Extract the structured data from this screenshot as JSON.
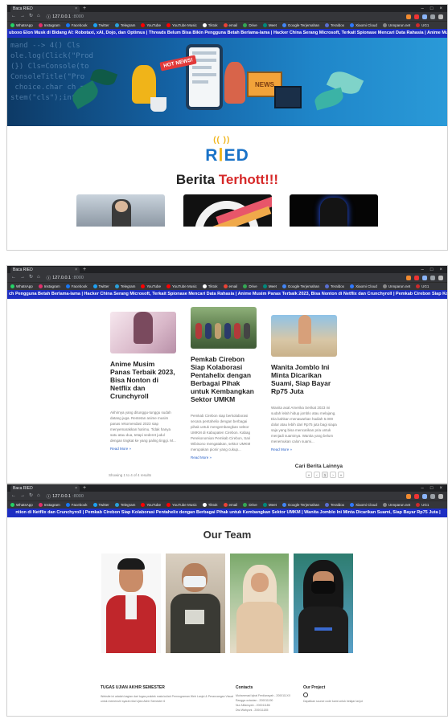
{
  "browser": {
    "tab_title": "Bacа RIED",
    "new_tab": "+",
    "url_host": "127.0.0.1",
    "url_port": ":8000",
    "url_host_2": "127.0.0.1",
    "url_port_2": ":8000",
    "url_host_3": "127.0.0.1",
    "url_port_3": ":8000",
    "bookmarks": [
      "WhatsApp",
      "Instagram",
      "Facebook",
      "Twitter",
      "Telegram",
      "YouTube",
      "YouTube Music",
      "Tiktok",
      "email",
      "Drive",
      "Meet",
      "Google Terjemahan",
      "Teraldox",
      "Xiaomi Cloud",
      "Unnparun.net",
      "UG1"
    ],
    "bookmark_colors": [
      "#25d366",
      "#e1306c",
      "#1877f2",
      "#1da1f2",
      "#2aa1da",
      "#ff0000",
      "#ff0000",
      "#ffffff",
      "#ea4335",
      "#34a853",
      "#00897b",
      "#4285f4",
      "#5a6fd0",
      "#2f78ff",
      "#888888",
      "#cc2b2b"
    ]
  },
  "screen1": {
    "ticker": "uboxo Elon Musk di Bidang AI: Robotaxi, xAI, Dojo, dan Optimus | Threads Belum Bisa Bikin Pengguna Betah Berlama-lama | Hacker China Serang Microsoft, Terkait Spionase Mencari Data Rahasia | Anime Musim Panas Terbaik 2023",
    "hero_badge": "HOT NEWS!",
    "hero_board": "NEWS",
    "logo_left": "R",
    "logo_right": "ED",
    "section_title_black": "Berita ",
    "section_title_red": "Terhott!!!"
  },
  "screen2": {
    "ticker": "ch Pengguna Betah Berlama-lama | Hacker China Serang Microsoft, Terkait Spionase Mencari Data Rahasia | Anime Musim Panas Terbaik 2023, Bisa Nonton di Netflix dan Crunchyroll | Pemkab Cirebon Siap Kolaborasi Pentahelix dengan",
    "cards": [
      {
        "title": "Anime Musim Panas Terbaik 2023, Bisa Nonton di Netflix dan Crunchyroll",
        "body": "Akhirnya yang ditunggu-tunggu sudah datang juga. Rentetan anime musim panas rekomendasi 2023 siap menyemarakkan harimu. Tidak hanya satu atau dua, tetapi sederet judul dengan tingkat ke yang paling tinggi. M...",
        "more": "Read More »"
      },
      {
        "title": "Pemkab Cirebon Siap Kolaborasi Pentahelix dengan Berbagai Pihak untuk Kembangkan Sektor UMKM",
        "body": "Pemkab Cirebon siap berkolaborasi secara pentahelix dengan berbagai pihak untuk mengembangkan sektor UMKM di Kabupaten Cirebon. Kabag Perekonomian Pemkab Cirebon, Sari Wibisono mengatakan, sektor UMKM merupakan pionir yang cukup...",
        "more": "Read More »"
      },
      {
        "title": "Wanita Jomblo Ini Minta Dicarikan Suami, Siap Bayar Rp75 Juta",
        "body": "Wanita asal Amerika Serikat 2023 ini sudah lelah hidup jomblo atau melajang. Dia bahkan menawarkan hadiah 5.000 dolar atau lebih dari Rp75 juta bagi siapa saja yang bisa mencarikan pria untuk menjadi suaminya. Wanita yang belum menemukan calon suami...",
        "more": "Read More »"
      }
    ],
    "showing": "Showing 1 to 4 of 4 results",
    "cari_label": "Cari Berita Lainnya",
    "pager": [
      "«",
      "‹",
      "1",
      "›",
      "»"
    ]
  },
  "screen3": {
    "ticker": "ntion di Netflix dan Crunchyroll | Pemkab Cirebon Siap Kolaborasi Pentahelix dengan Berbagai Pihak untuk Kembangkan Sektor UMKM | Wanita Jomblo Ini Minta Dicarikan Suami, Siap Bayar Rp75 Juta |",
    "team_title": "Our Team",
    "footer": {
      "about_title": "TUGAS UJIAN AKHIR SEMESTER",
      "about_text": "Website ini adalah bagian dari tugas praktek mata kuliah Pemrograman Web Lanjut & Perancangan Visual untuk memenuhi syarat nilai Ujian Akhir Semester 6",
      "contacts_title": "Contacts",
      "contacts": [
        "Muhammad Iqbal Ferdiansyah - 2000111XX",
        "Rangga octavian - 200011190",
        "Nur Alfiansyah - 200011186",
        "Dwi Wahyuni - 200011185"
      ],
      "project_title": "Our Project",
      "project_text": "Dapatkan source code kami untuk belajar lanjut"
    }
  }
}
